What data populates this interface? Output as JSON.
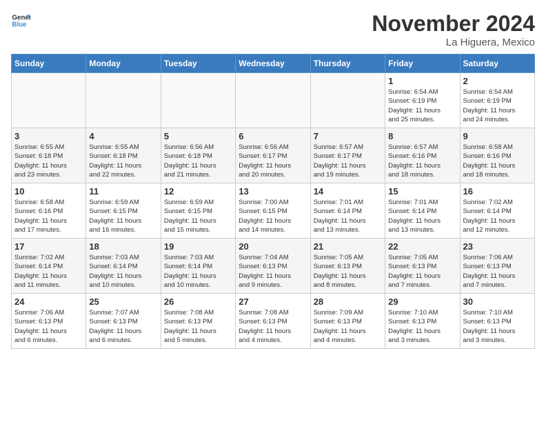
{
  "logo": {
    "line1": "General",
    "line2": "Blue"
  },
  "title": "November 2024",
  "location": "La Higuera, Mexico",
  "days_of_week": [
    "Sunday",
    "Monday",
    "Tuesday",
    "Wednesday",
    "Thursday",
    "Friday",
    "Saturday"
  ],
  "weeks": [
    [
      {
        "day": "",
        "info": ""
      },
      {
        "day": "",
        "info": ""
      },
      {
        "day": "",
        "info": ""
      },
      {
        "day": "",
        "info": ""
      },
      {
        "day": "",
        "info": ""
      },
      {
        "day": "1",
        "info": "Sunrise: 6:54 AM\nSunset: 6:19 PM\nDaylight: 11 hours\nand 25 minutes."
      },
      {
        "day": "2",
        "info": "Sunrise: 6:54 AM\nSunset: 6:19 PM\nDaylight: 11 hours\nand 24 minutes."
      }
    ],
    [
      {
        "day": "3",
        "info": "Sunrise: 6:55 AM\nSunset: 6:18 PM\nDaylight: 11 hours\nand 23 minutes."
      },
      {
        "day": "4",
        "info": "Sunrise: 6:55 AM\nSunset: 6:18 PM\nDaylight: 11 hours\nand 22 minutes."
      },
      {
        "day": "5",
        "info": "Sunrise: 6:56 AM\nSunset: 6:18 PM\nDaylight: 11 hours\nand 21 minutes."
      },
      {
        "day": "6",
        "info": "Sunrise: 6:56 AM\nSunset: 6:17 PM\nDaylight: 11 hours\nand 20 minutes."
      },
      {
        "day": "7",
        "info": "Sunrise: 6:57 AM\nSunset: 6:17 PM\nDaylight: 11 hours\nand 19 minutes."
      },
      {
        "day": "8",
        "info": "Sunrise: 6:57 AM\nSunset: 6:16 PM\nDaylight: 11 hours\nand 18 minutes."
      },
      {
        "day": "9",
        "info": "Sunrise: 6:58 AM\nSunset: 6:16 PM\nDaylight: 11 hours\nand 18 minutes."
      }
    ],
    [
      {
        "day": "10",
        "info": "Sunrise: 6:58 AM\nSunset: 6:16 PM\nDaylight: 11 hours\nand 17 minutes."
      },
      {
        "day": "11",
        "info": "Sunrise: 6:59 AM\nSunset: 6:15 PM\nDaylight: 11 hours\nand 16 minutes."
      },
      {
        "day": "12",
        "info": "Sunrise: 6:59 AM\nSunset: 6:15 PM\nDaylight: 11 hours\nand 15 minutes."
      },
      {
        "day": "13",
        "info": "Sunrise: 7:00 AM\nSunset: 6:15 PM\nDaylight: 11 hours\nand 14 minutes."
      },
      {
        "day": "14",
        "info": "Sunrise: 7:01 AM\nSunset: 6:14 PM\nDaylight: 11 hours\nand 13 minutes."
      },
      {
        "day": "15",
        "info": "Sunrise: 7:01 AM\nSunset: 6:14 PM\nDaylight: 11 hours\nand 13 minutes."
      },
      {
        "day": "16",
        "info": "Sunrise: 7:02 AM\nSunset: 6:14 PM\nDaylight: 11 hours\nand 12 minutes."
      }
    ],
    [
      {
        "day": "17",
        "info": "Sunrise: 7:02 AM\nSunset: 6:14 PM\nDaylight: 11 hours\nand 11 minutes."
      },
      {
        "day": "18",
        "info": "Sunrise: 7:03 AM\nSunset: 6:14 PM\nDaylight: 11 hours\nand 10 minutes."
      },
      {
        "day": "19",
        "info": "Sunrise: 7:03 AM\nSunset: 6:14 PM\nDaylight: 11 hours\nand 10 minutes."
      },
      {
        "day": "20",
        "info": "Sunrise: 7:04 AM\nSunset: 6:13 PM\nDaylight: 11 hours\nand 9 minutes."
      },
      {
        "day": "21",
        "info": "Sunrise: 7:05 AM\nSunset: 6:13 PM\nDaylight: 11 hours\nand 8 minutes."
      },
      {
        "day": "22",
        "info": "Sunrise: 7:05 AM\nSunset: 6:13 PM\nDaylight: 11 hours\nand 7 minutes."
      },
      {
        "day": "23",
        "info": "Sunrise: 7:06 AM\nSunset: 6:13 PM\nDaylight: 11 hours\nand 7 minutes."
      }
    ],
    [
      {
        "day": "24",
        "info": "Sunrise: 7:06 AM\nSunset: 6:13 PM\nDaylight: 11 hours\nand 6 minutes."
      },
      {
        "day": "25",
        "info": "Sunrise: 7:07 AM\nSunset: 6:13 PM\nDaylight: 11 hours\nand 6 minutes."
      },
      {
        "day": "26",
        "info": "Sunrise: 7:08 AM\nSunset: 6:13 PM\nDaylight: 11 hours\nand 5 minutes."
      },
      {
        "day": "27",
        "info": "Sunrise: 7:08 AM\nSunset: 6:13 PM\nDaylight: 11 hours\nand 4 minutes."
      },
      {
        "day": "28",
        "info": "Sunrise: 7:09 AM\nSunset: 6:13 PM\nDaylight: 11 hours\nand 4 minutes."
      },
      {
        "day": "29",
        "info": "Sunrise: 7:10 AM\nSunset: 6:13 PM\nDaylight: 11 hours\nand 3 minutes."
      },
      {
        "day": "30",
        "info": "Sunrise: 7:10 AM\nSunset: 6:13 PM\nDaylight: 11 hours\nand 3 minutes."
      }
    ]
  ]
}
